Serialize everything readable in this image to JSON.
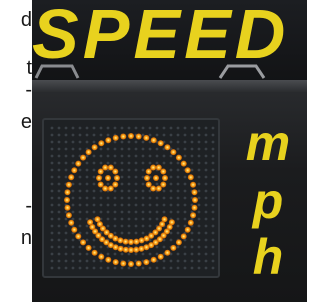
{
  "left_margin_fragments": [
    "d",
    "t",
    "-",
    "e",
    "-",
    "n"
  ],
  "sign": {
    "headline": "SPEED",
    "unit_letters": [
      "m",
      "p",
      "h"
    ]
  },
  "display": {
    "face": "smiley-face-icon"
  },
  "colors": {
    "sign_yellow": "#e8d21e",
    "led_amber": "#ff9a10",
    "cabinet_dark": "#1b1c1e",
    "board_dark": "#121315"
  }
}
